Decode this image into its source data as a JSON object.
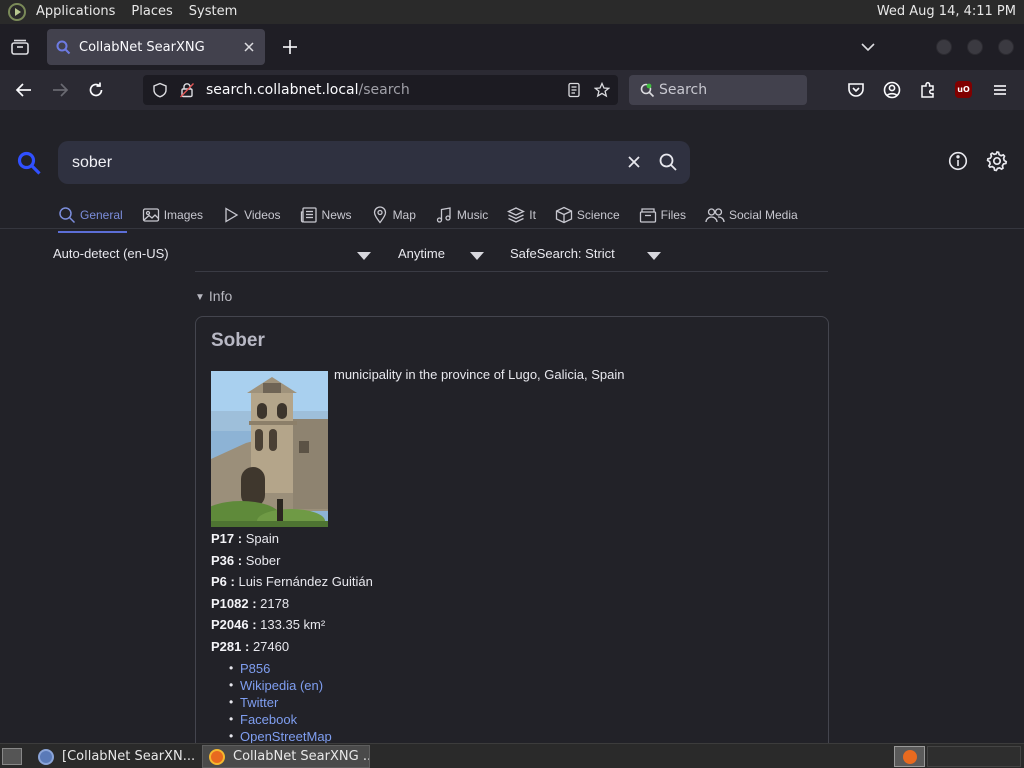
{
  "top_panel": {
    "menus": [
      "Applications",
      "Places",
      "System"
    ],
    "clock": "Wed Aug 14,  4:11 PM"
  },
  "browser": {
    "tab": {
      "title": "CollabNet SearXNG"
    },
    "url": {
      "host": "search.collabnet.local",
      "path": "/search"
    },
    "searchbar_placeholder": "Search"
  },
  "search": {
    "query": "sober",
    "categories": [
      {
        "label": "General",
        "icon": "search-icon",
        "active": true
      },
      {
        "label": "Images",
        "icon": "image-icon",
        "active": false
      },
      {
        "label": "Videos",
        "icon": "play-icon",
        "active": false
      },
      {
        "label": "News",
        "icon": "newspaper-icon",
        "active": false
      },
      {
        "label": "Map",
        "icon": "map-pin-icon",
        "active": false
      },
      {
        "label": "Music",
        "icon": "music-icon",
        "active": false
      },
      {
        "label": "It",
        "icon": "layers-icon",
        "active": false
      },
      {
        "label": "Science",
        "icon": "cube-icon",
        "active": false
      },
      {
        "label": "Files",
        "icon": "file-box-icon",
        "active": false
      },
      {
        "label": "Social Media",
        "icon": "people-icon",
        "active": false
      }
    ],
    "filters": {
      "language": "Auto-detect (en-US)",
      "time_range": "Anytime",
      "safesearch": "SafeSearch: Strict"
    }
  },
  "infobox": {
    "summary_label": "Info",
    "title": "Sober",
    "description": "municipality in the province of Lugo, Galicia, Spain",
    "attributes": [
      {
        "label": "P17 :",
        "value": "Spain"
      },
      {
        "label": "P36 :",
        "value": "Sober"
      },
      {
        "label": "P6 :",
        "value": "Luis Fernández Guitián"
      },
      {
        "label": "P1082 :",
        "value": "2178"
      },
      {
        "label": "P2046 :",
        "value": "133.35 km²"
      },
      {
        "label": "P281 :",
        "value": "27460"
      }
    ],
    "links": [
      "P856",
      "Wikipedia (en)",
      "Twitter",
      "Facebook",
      "OpenStreetMap"
    ]
  },
  "taskbar": {
    "tasks": [
      {
        "label": "[CollabNet SearXN...",
        "active": false
      },
      {
        "label": "CollabNet SearXNG ...",
        "active": true
      }
    ]
  },
  "colors": {
    "accent": "#3050ff",
    "link": "#7f9ef0",
    "page_bg": "#222228",
    "active_category": "#7b8ddb"
  }
}
